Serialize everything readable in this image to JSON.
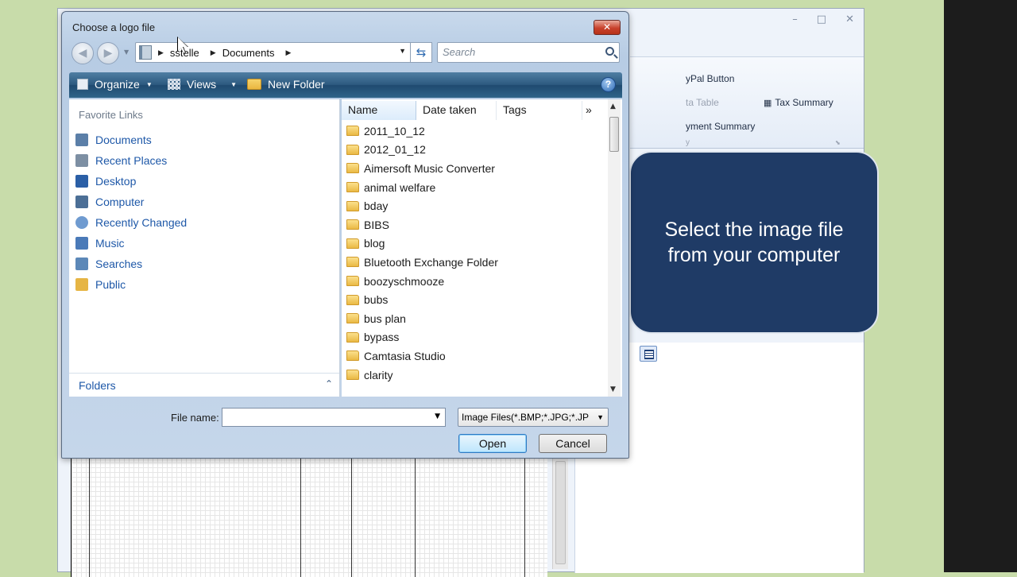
{
  "dialog": {
    "title": "Choose a logo file",
    "close_label": "✕",
    "breadcrumb": [
      "sstelle",
      "Documents"
    ],
    "search_placeholder": "Search",
    "toolbar": {
      "organize": "Organize",
      "views": "Views",
      "new_folder": "New Folder"
    },
    "favorite_links_heading": "Favorite Links",
    "favorite_links": [
      {
        "label": "Documents",
        "icon": "documents-icon",
        "color": "#5b7fa8"
      },
      {
        "label": "Recent Places",
        "icon": "recent-places-icon",
        "color": "#7d8fa3"
      },
      {
        "label": "Desktop",
        "icon": "desktop-icon",
        "color": "#2b5fa6"
      },
      {
        "label": "Computer",
        "icon": "computer-icon",
        "color": "#4c6f96"
      },
      {
        "label": "Recently Changed",
        "icon": "recently-changed-icon",
        "color": "#6f9bd0"
      },
      {
        "label": "Music",
        "icon": "music-icon",
        "color": "#4a7ab8"
      },
      {
        "label": "Searches",
        "icon": "searches-icon",
        "color": "#5c88b8"
      },
      {
        "label": "Public",
        "icon": "public-folder-icon",
        "color": "#e6b544"
      }
    ],
    "folders_label": "Folders",
    "columns": [
      "Name",
      "Date taken",
      "Tags",
      "»"
    ],
    "files": [
      "2011_10_12",
      "2012_01_12",
      "Aimersoft Music Converter",
      "animal welfare",
      "bday",
      "BIBS",
      "blog",
      "Bluetooth Exchange Folder",
      "boozyschmooze",
      "bubs",
      "bus plan",
      "bypass",
      "Camtasia Studio",
      "clarity"
    ],
    "file_name_label": "File name:",
    "file_name_value": "",
    "file_type": "Image Files(*.BMP;*.JPG;*.JP",
    "open_label": "Open",
    "cancel_label": "Cancel"
  },
  "background_app": {
    "ribbon": {
      "paypal_button": "yPal Button",
      "data_table": "ta Table",
      "tax_summary": "Tax Summary",
      "payment_summary": "yment Summary",
      "group_fragment": "y"
    },
    "window_controls": [
      "–",
      "□",
      "✕"
    ]
  },
  "callout": {
    "text": "Select the image file\nfrom your computer"
  }
}
